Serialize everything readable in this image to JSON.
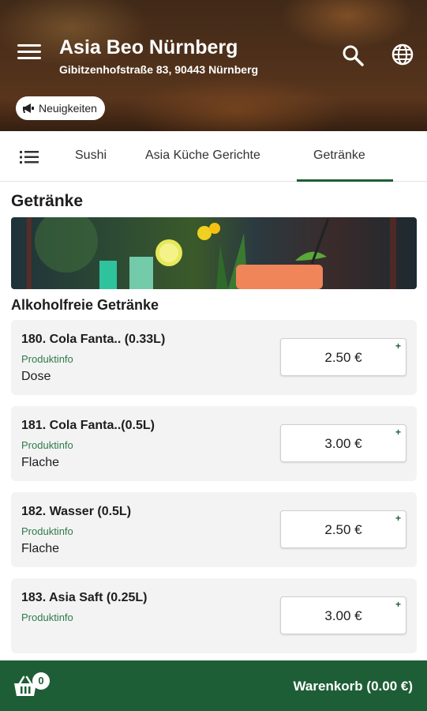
{
  "header": {
    "shop_name": "Asia Beo Nürnberg",
    "address": "Gibitzenhofstraße 83, 90443 Nürnberg",
    "news_label": "Neuigkeiten",
    "icons": [
      "menu-icon",
      "search-icon",
      "globe-icon",
      "megaphone-icon"
    ]
  },
  "tabs": {
    "items": [
      {
        "label": "Sushi"
      },
      {
        "label": "Asia Küche Gerichte"
      },
      {
        "label": "Getränke"
      }
    ],
    "active": "Getränke",
    "accent_color": "#1e5e36"
  },
  "section": {
    "title": "Getränke",
    "category": "Alkoholfreie Getränke"
  },
  "products": [
    {
      "name": "180. Cola Fanta.. (0.33L)",
      "info": "Produktinfo",
      "sub": "Dose",
      "price": "2.50 €",
      "plus": "+"
    },
    {
      "name": "181. Cola Fanta..(0.5L)",
      "info": "Produktinfo",
      "sub": "Flache",
      "price": "3.00 €",
      "plus": "+"
    },
    {
      "name": "182. Wasser (0.5L)",
      "info": "Produktinfo",
      "sub": "Flache",
      "price": "2.50 €",
      "plus": "+"
    },
    {
      "name": "183. Asia Saft (0.25L)",
      "info": "Produktinfo",
      "sub": "",
      "price": "3.00 €",
      "plus": "+"
    }
  ],
  "cart": {
    "count": "0",
    "label": "Warenkorb (0.00 €)",
    "bar_color": "#1e5e36"
  }
}
